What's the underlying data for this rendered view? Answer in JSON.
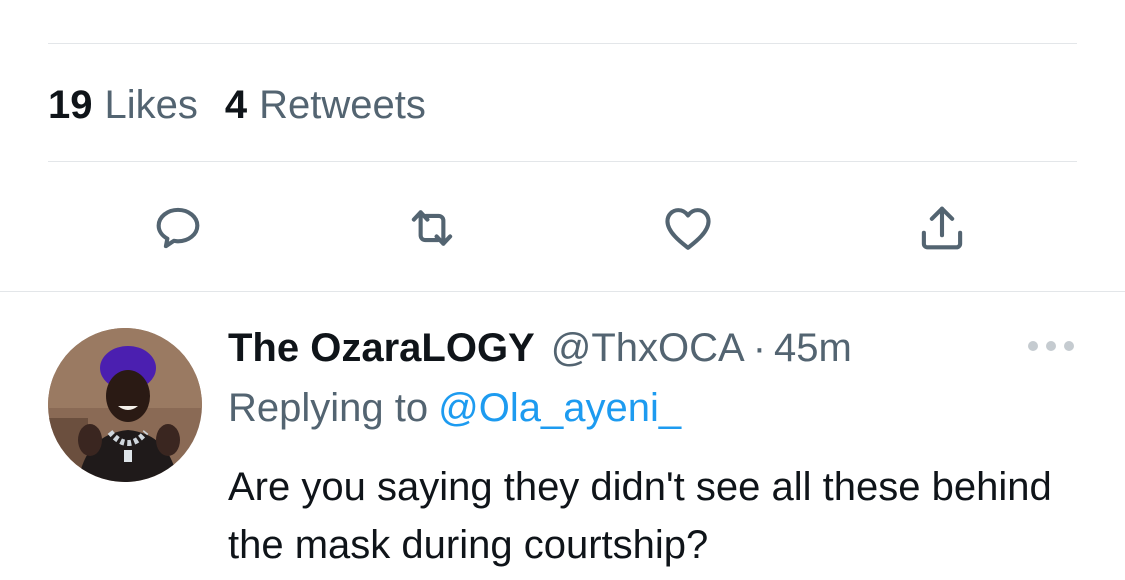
{
  "stats": {
    "likes_count": "19",
    "likes_label": "Likes",
    "retweets_count": "4",
    "retweets_label": "Retweets"
  },
  "actions": [
    {
      "name": "reply",
      "icon": "reply-icon"
    },
    {
      "name": "retweet",
      "icon": "retweet-icon"
    },
    {
      "name": "like",
      "icon": "heart-icon"
    },
    {
      "name": "share",
      "icon": "share-icon"
    }
  ],
  "reply_tweet": {
    "author_name": "The OzaraLOGY",
    "author_handle": "@ThxOCA",
    "separator": "·",
    "time": "45m",
    "replying_label": "Replying to",
    "replying_handle": "@Ola_ayeni_",
    "text": "Are you saying they didn't see all these behind the mask during courtship?",
    "avatar_icon": "user-avatar"
  },
  "colors": {
    "text_primary": "#0f1419",
    "text_secondary": "#536471",
    "accent": "#1d9bf0",
    "divider": "#e3e6e9",
    "icon": "#536471"
  }
}
